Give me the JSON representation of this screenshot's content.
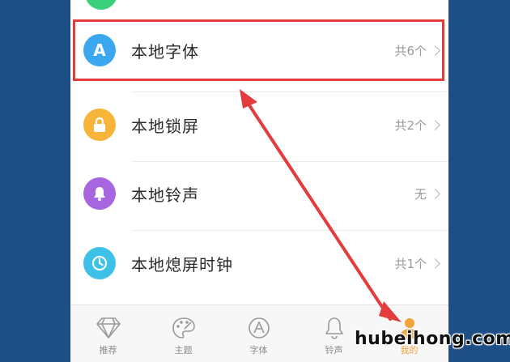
{
  "list": {
    "items": [
      {
        "label": "本地字体",
        "meta": "共6个",
        "icon": "font-icon",
        "icon_text": "A",
        "color": "#3aa7ef"
      },
      {
        "label": "本地锁屏",
        "meta": "共2个",
        "icon": "lock-icon",
        "color": "#f7b53a"
      },
      {
        "label": "本地铃声",
        "meta": "无",
        "icon": "bell-icon",
        "color": "#a766e0"
      },
      {
        "label": "本地熄屏时钟",
        "meta": "共1个",
        "icon": "clock-icon",
        "color": "#3ec1e8"
      }
    ]
  },
  "tabbar": {
    "tabs": [
      {
        "label": "推荐",
        "icon": "diamond-icon"
      },
      {
        "label": "主题",
        "icon": "palette-icon"
      },
      {
        "label": "字体",
        "icon": "font-tab-icon"
      },
      {
        "label": "铃声",
        "icon": "bell-tab-icon"
      },
      {
        "label": "我的",
        "icon": "person-icon",
        "active": true
      }
    ]
  },
  "watermark": "hubeihong.com",
  "colors": {
    "highlight": "#e23c3c",
    "accent": "#f1a43a",
    "background": "#1d4e86"
  }
}
